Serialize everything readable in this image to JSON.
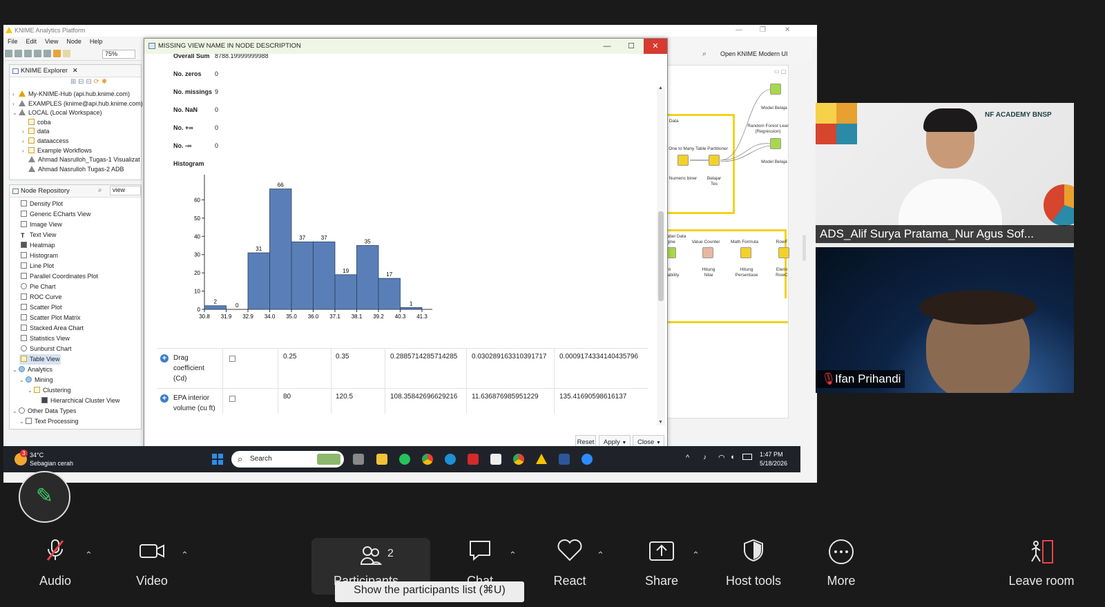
{
  "app": {
    "title": "KNIME Analytics Platform",
    "menu": [
      "File",
      "Edit",
      "View",
      "Node",
      "Help"
    ],
    "zoom": "75%",
    "open_modern": "Open KNIME Modern UI"
  },
  "explorer": {
    "title": "KNIME Explorer",
    "items": [
      "My-KNIME-Hub (api.hub.knime.com)",
      "EXAMPLES (knime@api.hub.knime.com)",
      "LOCAL (Local Workspace)",
      "coba",
      "data",
      "dataaccess",
      "Example Workflows",
      "Ahmad Nasrulloh_Tugas-1 Visualizat",
      "Ahmad Nasrulloh Tugas-2 ADB"
    ]
  },
  "repo": {
    "title": "Node Repository",
    "search": "view",
    "items": [
      "Density Plot",
      "Generic ECharts View",
      "Image View",
      "Text View",
      "Heatmap",
      "Histogram",
      "Line Plot",
      "Parallel Coordinates Plot",
      "Pie Chart",
      "ROC Curve",
      "Scatter Plot",
      "Scatter Plot Matrix",
      "Stacked Area Chart",
      "Statistics View",
      "Sunburst Chart",
      "Table View",
      "Analytics",
      "Mining",
      "Clustering",
      "Hierarchical Cluster View",
      "Other Data Types",
      "Text Processing"
    ]
  },
  "canvas": {
    "labels": {
      "model1": "Model Belaja",
      "rfl": "Random Forest Lear (Regression)",
      "model2": "Model Belaja",
      "partitioner": "One to Many Table Partitioner",
      "numeric": "Numeric biner",
      "belajar": "Belajar Tes",
      "data1": "al Data",
      "label": "Label Data ngine",
      "value_counter": "Value Counter",
      "math": "Math Formula",
      "rowf": "RowF",
      "hitung1": "Hitung Nilai",
      "hitung2": "Hitung Persentase",
      "el1": "lom erability",
      "el2": "Elemi RowC"
    }
  },
  "dialog": {
    "title": "MISSING VIEW NAME IN NODE DESCRIPTION",
    "overall_sum_label": "Overall Sum",
    "overall_sum": "8788.19999999988",
    "stats": [
      {
        "label": "No. zeros",
        "value": "0"
      },
      {
        "label": "No. missings",
        "value": "9"
      },
      {
        "label": "No. NaN",
        "value": "0"
      },
      {
        "label": "No. +∞",
        "value": "0"
      },
      {
        "label": "No. -∞",
        "value": "0"
      }
    ],
    "histogram_label": "Histogram",
    "rows": [
      {
        "name": "Drag coefficient (Cd)",
        "c1": "0.25",
        "c2": "0.35",
        "c3": "0.2885714285714285",
        "c4": "0.030289163310391717",
        "c5": "0.0009174334140435796"
      },
      {
        "name": "EPA interior volume (cu ft)",
        "c1": "80",
        "c2": "120.5",
        "c3": "108.35842696629216",
        "c4": "11.636876985951229",
        "c5": "135.41690598616137"
      }
    ],
    "buttons": {
      "reset": "Reset",
      "apply": "Apply",
      "close": "Close"
    }
  },
  "chart_data": {
    "type": "bar",
    "categories": [
      "30.8",
      "31.9",
      "32.9",
      "34.0",
      "35.0",
      "36.0",
      "37.1",
      "38.1",
      "39.2",
      "40.3",
      "41.3"
    ],
    "values": [
      2,
      0,
      31,
      66,
      37,
      37,
      19,
      35,
      17,
      1
    ],
    "ylim": [
      0,
      70
    ],
    "yticks": [
      0,
      10,
      20,
      30,
      40,
      50,
      60
    ],
    "color": "#5a7fb8"
  },
  "taskbar": {
    "weather_temp": "34°C",
    "weather_desc": "Sebagian cerah",
    "search": "Search",
    "time": "1:47 PM",
    "date": "5/18/2026",
    "badge": "3"
  },
  "meeting": {
    "participant1": "ADS_Alif Surya Pratama_Nur Agus Sof...",
    "participant2": "Ifan Prihandi",
    "brand": "NF ACADEMY  BNSP",
    "controls": {
      "audio": "Audio",
      "video": "Video",
      "participants": "Participants",
      "participant_count": "2",
      "chat": "Chat",
      "react": "React",
      "share": "Share",
      "host": "Host tools",
      "more": "More",
      "leave": "Leave room"
    },
    "tooltip": "Show the participants list (⌘U)"
  }
}
